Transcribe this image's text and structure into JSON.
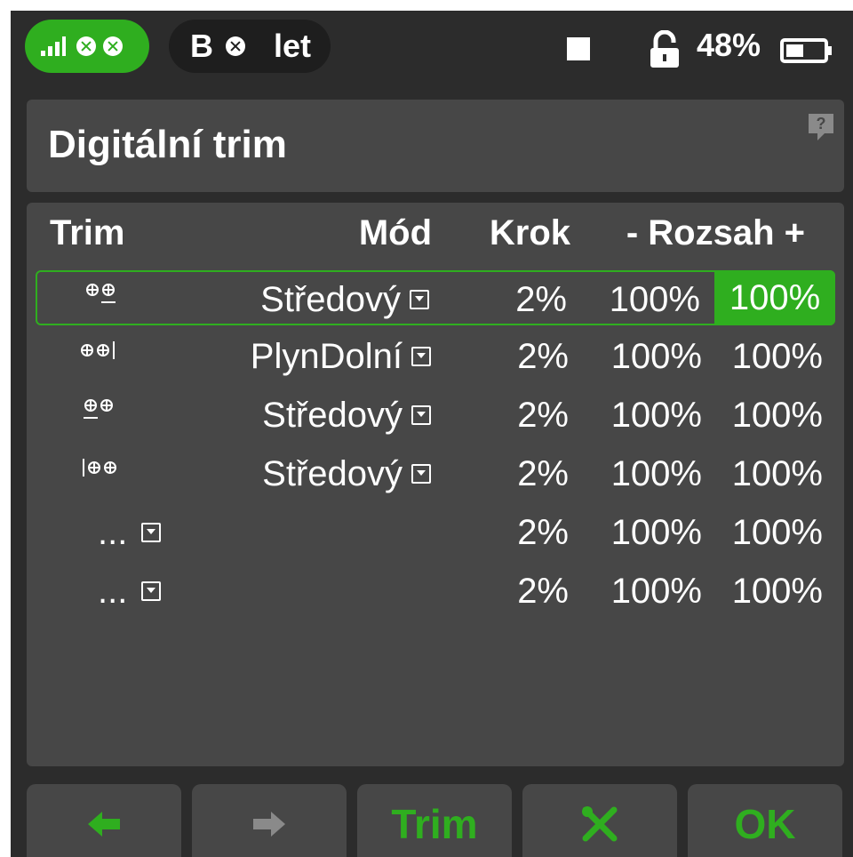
{
  "status": {
    "mode_letter": "B",
    "flight_label": "let",
    "battery_percent": "48%",
    "battery_level": 0.48
  },
  "title": "Digitální trim",
  "table": {
    "headers": {
      "trim": "Trim",
      "mode": "Mód",
      "step": "Krok",
      "range": "- Rozsah +"
    },
    "rows": [
      {
        "icon": "trim-right-horizontal-icon",
        "mode": "Středový",
        "step": "2%",
        "neg": "100%",
        "pos": "100%"
      },
      {
        "icon": "trim-right-vertical-icon",
        "mode": "PlynDolní",
        "step": "2%",
        "neg": "100%",
        "pos": "100%"
      },
      {
        "icon": "trim-left-horizontal-icon",
        "mode": "Středový",
        "step": "2%",
        "neg": "100%",
        "pos": "100%"
      },
      {
        "icon": "trim-left-vertical-icon",
        "mode": "Středový",
        "step": "2%",
        "neg": "100%",
        "pos": "100%"
      },
      {
        "icon": "",
        "mode": "...",
        "step": "2%",
        "neg": "100%",
        "pos": "100%"
      },
      {
        "icon": "",
        "mode": "...",
        "step": "2%",
        "neg": "100%",
        "pos": "100%"
      }
    ]
  },
  "buttons": {
    "back_icon": "arrow-left-icon",
    "next_icon": "arrow-right-icon",
    "trim_label": "Trim",
    "tools_icon": "tools-icon",
    "ok_label": "OK"
  },
  "colors": {
    "accent": "#2fae1f",
    "panel": "#474747",
    "background": "#2c2c2c"
  }
}
